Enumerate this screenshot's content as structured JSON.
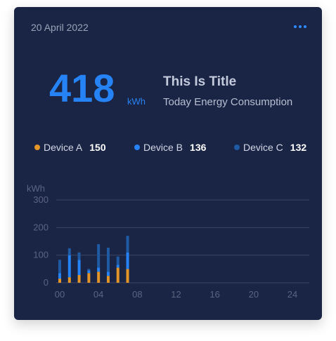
{
  "header": {
    "date": "20 April 2022",
    "more_icon": "more-horizontal-icon"
  },
  "summary": {
    "value": "418",
    "unit": "kWh",
    "title": "This Is Title",
    "subtitle": "Today Energy Consumption"
  },
  "legend": [
    {
      "name": "Device A",
      "value": "150",
      "color": "#e39527"
    },
    {
      "name": "Device B",
      "value": "136",
      "color": "#2683f5"
    },
    {
      "name": "Device C",
      "value": "132",
      "color": "#1f5ba5"
    }
  ],
  "chart_data": {
    "type": "bar",
    "stacked": true,
    "ylabel": "kWh",
    "ylim": [
      0,
      300
    ],
    "yticks": [
      0,
      100,
      200,
      300
    ],
    "xlim": [
      0,
      24
    ],
    "xticks": [
      "00",
      "04",
      "08",
      "12",
      "16",
      "20",
      "24"
    ],
    "x": [
      0,
      1,
      2,
      3,
      4,
      5,
      6,
      7
    ],
    "series": [
      {
        "name": "Device A",
        "color": "#e39527",
        "values": [
          15,
          20,
          28,
          35,
          40,
          25,
          55,
          50
        ]
      },
      {
        "name": "Device B",
        "color": "#2683f5",
        "values": [
          20,
          80,
          55,
          10,
          15,
          15,
          10,
          60
        ]
      },
      {
        "name": "Device C",
        "color": "#1f5ba5",
        "values": [
          48,
          25,
          27,
          5,
          85,
          87,
          30,
          60
        ]
      }
    ],
    "grid": true
  }
}
